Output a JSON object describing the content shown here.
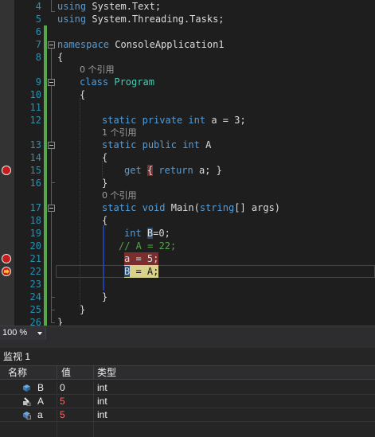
{
  "editor": {
    "lines": [
      {
        "num": "4",
        "text": "using System.Text;"
      },
      {
        "num": "5",
        "text": "using System.Threading.Tasks;"
      },
      {
        "num": "6",
        "text": ""
      },
      {
        "num": "7",
        "text": "namespace ConsoleApplication1"
      },
      {
        "num": "8",
        "text": "{"
      },
      {
        "num": "",
        "ref": "0 个引用"
      },
      {
        "num": "9",
        "text": "class Program"
      },
      {
        "num": "10",
        "text": "{"
      },
      {
        "num": "11",
        "text": ""
      },
      {
        "num": "12",
        "text": "static private int a = 3;"
      },
      {
        "num": "",
        "ref": "1 个引用"
      },
      {
        "num": "13",
        "text": "static public int A"
      },
      {
        "num": "14",
        "text": "{"
      },
      {
        "num": "15",
        "text": "get { return a; }"
      },
      {
        "num": "16",
        "text": "}"
      },
      {
        "num": "",
        "ref": "0 个引用"
      },
      {
        "num": "17",
        "text": "static void Main(string[] args)"
      },
      {
        "num": "18",
        "text": "{"
      },
      {
        "num": "19",
        "text": "int B=0;"
      },
      {
        "num": "20",
        "text": "// A = 22;"
      },
      {
        "num": "21",
        "text": "a = 5;"
      },
      {
        "num": "22",
        "text": "B = A;"
      },
      {
        "num": "23",
        "text": ""
      },
      {
        "num": "24",
        "text": "}"
      },
      {
        "num": "25",
        "text": "}"
      },
      {
        "num": "26",
        "text": "}"
      }
    ],
    "refs": {
      "class_program": "0 个引用",
      "prop_a": "1 个引用",
      "main": "0 个引用"
    },
    "breakpoint_lines": [
      "15",
      "21"
    ],
    "current_line": "22",
    "colors": {
      "breakpoint": "#c81c1c",
      "current_statement": "#d9d28a",
      "keyword": "#569cd6",
      "type": "#4ec9b0",
      "comment": "#57a64a",
      "line_number": "#2b91af"
    }
  },
  "zoom": {
    "level": "100 %"
  },
  "watch": {
    "title": "监视 1",
    "columns": [
      "名称",
      "值",
      "类型"
    ],
    "rows": [
      {
        "name": "B",
        "value": "0",
        "type": "int",
        "icon": "variable-icon",
        "changed": false
      },
      {
        "name": "A",
        "value": "5",
        "type": "int",
        "icon": "property-icon",
        "changed": true
      },
      {
        "name": "a",
        "value": "5",
        "type": "int",
        "icon": "field-icon",
        "changed": true
      }
    ]
  }
}
